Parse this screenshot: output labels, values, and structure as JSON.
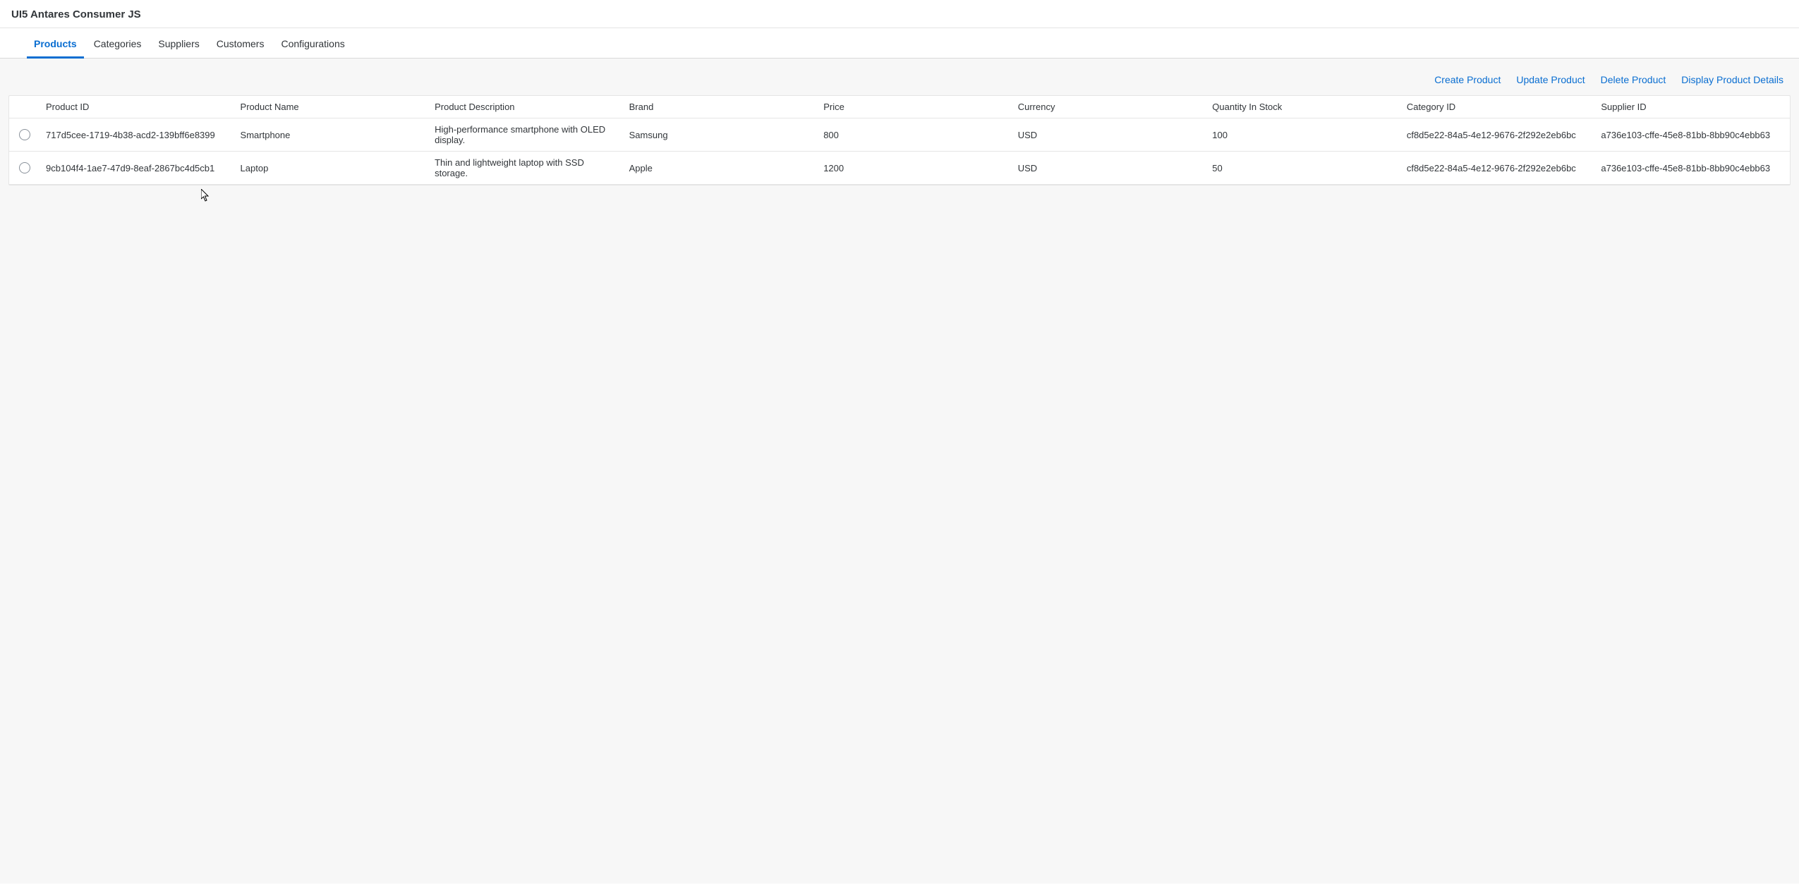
{
  "header": {
    "title": "UI5 Antares Consumer JS"
  },
  "tabs": [
    {
      "label": "Products",
      "active": true
    },
    {
      "label": "Categories",
      "active": false
    },
    {
      "label": "Suppliers",
      "active": false
    },
    {
      "label": "Customers",
      "active": false
    },
    {
      "label": "Configurations",
      "active": false
    }
  ],
  "toolbar": {
    "create": "Create Product",
    "update": "Update Product",
    "delete": "Delete Product",
    "details": "Display Product Details"
  },
  "columns": {
    "product_id": "Product ID",
    "product_name": "Product Name",
    "product_description": "Product Description",
    "brand": "Brand",
    "price": "Price",
    "currency": "Currency",
    "quantity_in_stock": "Quantity In Stock",
    "category_id": "Category ID",
    "supplier_id": "Supplier ID"
  },
  "rows": [
    {
      "product_id": "717d5cee-1719-4b38-acd2-139bff6e8399",
      "product_name": "Smartphone",
      "product_description": "High-performance smartphone with OLED display.",
      "brand": "Samsung",
      "price": "800",
      "currency": "USD",
      "quantity_in_stock": "100",
      "category_id": "cf8d5e22-84a5-4e12-9676-2f292e2eb6bc",
      "supplier_id": "a736e103-cffe-45e8-81bb-8bb90c4ebb63"
    },
    {
      "product_id": "9cb104f4-1ae7-47d9-8eaf-2867bc4d5cb1",
      "product_name": "Laptop",
      "product_description": "Thin and lightweight laptop with SSD storage.",
      "brand": "Apple",
      "price": "1200",
      "currency": "USD",
      "quantity_in_stock": "50",
      "category_id": "cf8d5e22-84a5-4e12-9676-2f292e2eb6bc",
      "supplier_id": "a736e103-cffe-45e8-81bb-8bb90c4ebb63"
    }
  ]
}
